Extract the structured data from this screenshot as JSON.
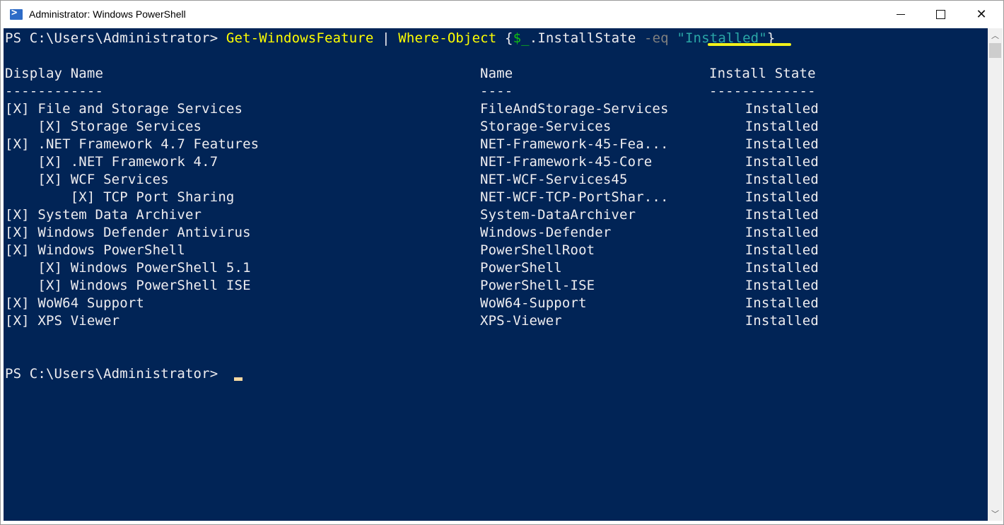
{
  "window": {
    "title": "Administrator: Windows PowerShell",
    "icon": "powershell-icon",
    "controls": {
      "minimize": "minimize-icon",
      "maximize": "maximize-icon",
      "close": "close-icon"
    }
  },
  "console": {
    "prompt": "PS C:\\Users\\Administrator> ",
    "command": {
      "cmdlet1": "Get-WindowsFeature",
      "pipe": " | ",
      "cmdlet2": "Where-Object",
      "brace_open": " {",
      "variable": "$_",
      "property": ".InstallState ",
      "operator": "-eq",
      "space": " ",
      "quote_open": "\"",
      "string_value": "Installed",
      "quote_close": "\"",
      "brace_close": "}"
    },
    "table": {
      "headers": [
        "Display Name",
        "Name",
        "Install State"
      ],
      "separators": [
        "------------",
        "----",
        "-------------"
      ],
      "rows": [
        {
          "display": "[X] File and Storage Services",
          "name": "FileAndStorage-Services",
          "state": "Installed"
        },
        {
          "display": "    [X] Storage Services",
          "name": "Storage-Services",
          "state": "Installed"
        },
        {
          "display": "[X] .NET Framework 4.7 Features",
          "name": "NET-Framework-45-Fea...",
          "state": "Installed"
        },
        {
          "display": "    [X] .NET Framework 4.7",
          "name": "NET-Framework-45-Core",
          "state": "Installed"
        },
        {
          "display": "    [X] WCF Services",
          "name": "NET-WCF-Services45",
          "state": "Installed"
        },
        {
          "display": "        [X] TCP Port Sharing",
          "name": "NET-WCF-TCP-PortShar...",
          "state": "Installed"
        },
        {
          "display": "[X] System Data Archiver",
          "name": "System-DataArchiver",
          "state": "Installed"
        },
        {
          "display": "[X] Windows Defender Antivirus",
          "name": "Windows-Defender",
          "state": "Installed"
        },
        {
          "display": "[X] Windows PowerShell",
          "name": "PowerShellRoot",
          "state": "Installed"
        },
        {
          "display": "    [X] Windows PowerShell 5.1",
          "name": "PowerShell",
          "state": "Installed"
        },
        {
          "display": "    [X] Windows PowerShell ISE",
          "name": "PowerShell-ISE",
          "state": "Installed"
        },
        {
          "display": "[X] WoW64 Support",
          "name": "WoW64-Support",
          "state": "Installed"
        },
        {
          "display": "[X] XPS Viewer",
          "name": "XPS-Viewer",
          "state": "Installed"
        }
      ]
    },
    "final_prompt": "PS C:\\Users\\Administrator> "
  },
  "scrollbar": {
    "up": "▲",
    "down": "▼"
  }
}
